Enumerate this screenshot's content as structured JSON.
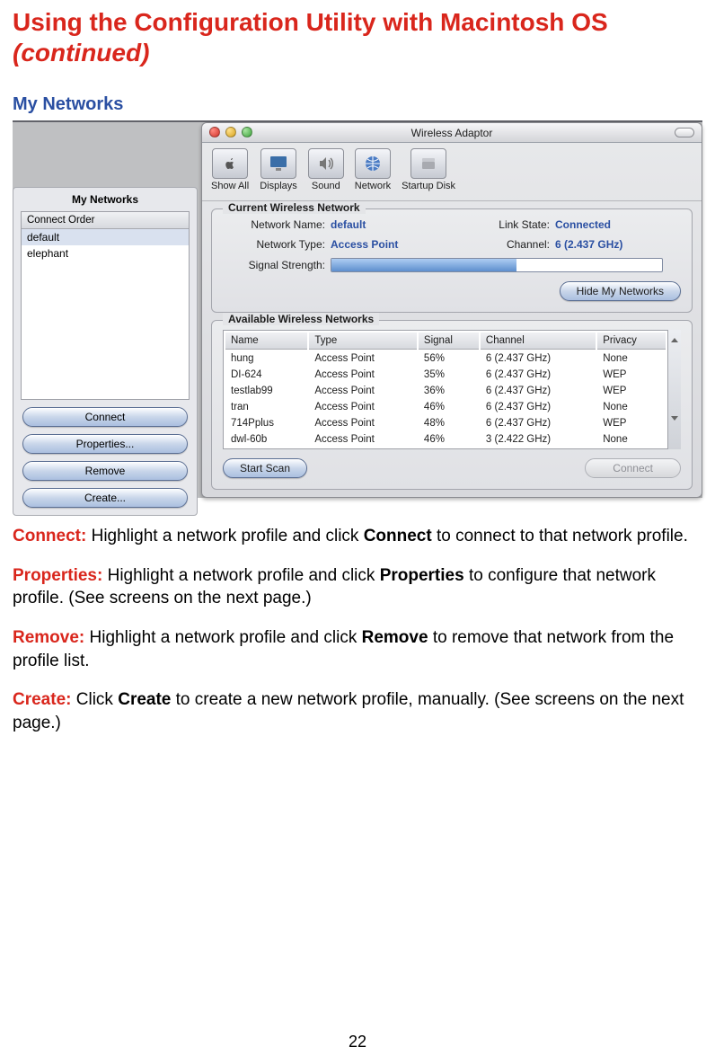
{
  "page": {
    "title_line1": "Using the Configuration Utility with Macintosh OS",
    "title_line2": "(continued)",
    "section": "My Networks",
    "number": "22"
  },
  "window": {
    "title": "Wireless Adaptor",
    "toolbar": {
      "show_all": "Show All",
      "displays": "Displays",
      "sound": "Sound",
      "network": "Network",
      "startup": "Startup Disk"
    },
    "current": {
      "legend": "Current Wireless Network",
      "name_label": "Network Name:",
      "name_value": "default",
      "type_label": "Network Type:",
      "type_value": "Access Point",
      "link_label": "Link State:",
      "link_value": "Connected",
      "channel_label": "Channel:",
      "channel_value": "6 (2.437 GHz)",
      "signal_label": "Signal Strength:",
      "hide_btn": "Hide My Networks"
    },
    "available": {
      "legend": "Available Wireless Networks",
      "headers": {
        "name": "Name",
        "type": "Type",
        "signal": "Signal",
        "channel": "Channel",
        "privacy": "Privacy"
      },
      "rows": [
        {
          "name": "hung",
          "type": "Access Point",
          "signal": "56%",
          "channel": "6 (2.437 GHz)",
          "privacy": "None"
        },
        {
          "name": "DI-624",
          "type": "Access Point",
          "signal": "35%",
          "channel": "6 (2.437 GHz)",
          "privacy": "WEP"
        },
        {
          "name": "testlab99",
          "type": "Access Point",
          "signal": "36%",
          "channel": "6 (2.437 GHz)",
          "privacy": "WEP"
        },
        {
          "name": "tran",
          "type": "Access Point",
          "signal": "46%",
          "channel": "6 (2.437 GHz)",
          "privacy": "None"
        },
        {
          "name": "714Pplus",
          "type": "Access Point",
          "signal": "48%",
          "channel": "6 (2.437 GHz)",
          "privacy": "WEP"
        },
        {
          "name": "dwl-60b",
          "type": "Access Point",
          "signal": "46%",
          "channel": "3 (2.422 GHz)",
          "privacy": "None"
        }
      ],
      "start_scan": "Start Scan",
      "connect": "Connect"
    }
  },
  "sidebar": {
    "title": "My Networks",
    "list_header": "Connect Order",
    "items": [
      "default",
      "elephant"
    ],
    "buttons": {
      "connect": "Connect",
      "properties": "Properties...",
      "remove": "Remove",
      "create": "Create..."
    }
  },
  "desc": {
    "connect_term": "Connect:",
    "connect_a": " Highlight a network profile and click ",
    "connect_bold": "Connect",
    "connect_b": " to connect to that net­work profile.",
    "properties_term": "Properties:",
    "properties_a": " Highlight a network profile and click ",
    "properties_bold": "Properties",
    "properties_b": " to configure that network profile. (See screens on the next page.)",
    "remove_term": "Remove:",
    "remove_a": " Highlight a network profile and click ",
    "remove_bold": "Remove",
    "remove_b": " to remove that network from the profile list.",
    "create_term": "Create:",
    "create_a": " Click ",
    "create_bold": "Create",
    "create_b": " to create a new network profile, manually. (See screens on the next page.)"
  }
}
